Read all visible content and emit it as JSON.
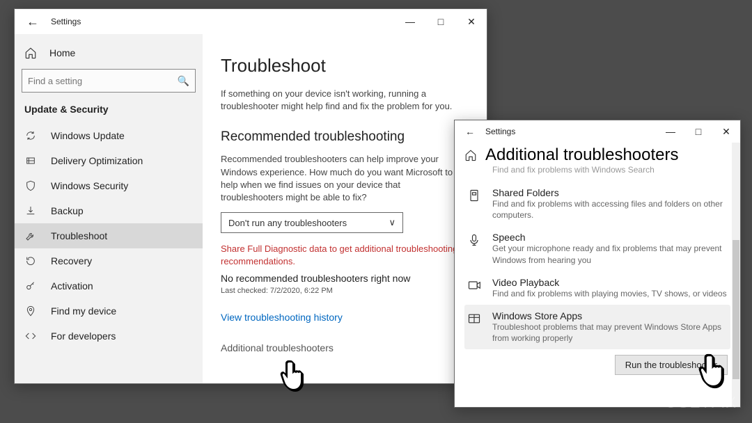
{
  "window1": {
    "title": "Settings",
    "home": "Home",
    "search_placeholder": "Find a setting",
    "category": "Update & Security",
    "sidebar": {
      "items": [
        {
          "label": "Windows Update"
        },
        {
          "label": "Delivery Optimization"
        },
        {
          "label": "Windows Security"
        },
        {
          "label": "Backup"
        },
        {
          "label": "Troubleshoot"
        },
        {
          "label": "Recovery"
        },
        {
          "label": "Activation"
        },
        {
          "label": "Find my device"
        },
        {
          "label": "For developers"
        }
      ]
    },
    "page": {
      "title": "Troubleshoot",
      "intro": "If something on your device isn't working, running a troubleshooter might help find and fix the problem for you.",
      "section_title": "Recommended troubleshooting",
      "section_desc": "Recommended troubleshooters can help improve your Windows experience. How much do you want Microsoft to help when we find issues on your device that troubleshooters might be able to fix?",
      "dropdown_value": "Don't run any troubleshooters",
      "warning": "Share Full Diagnostic data to get additional troubleshooting recommendations.",
      "no_rec": "No recommended troubleshooters right now",
      "last_checked": "Last checked: 7/2/2020, 6:22 PM",
      "history_link": "View troubleshooting history",
      "additional_link": "Additional troubleshooters"
    }
  },
  "window2": {
    "title": "Settings",
    "page_title": "Additional troubleshooters",
    "faded_line": "Find and fix problems with Windows Search",
    "items": [
      {
        "title": "Shared Folders",
        "desc": "Find and fix problems with accessing files and folders on other computers."
      },
      {
        "title": "Speech",
        "desc": "Get your microphone ready and fix problems that may prevent Windows from hearing you"
      },
      {
        "title": "Video Playback",
        "desc": "Find and fix problems with playing movies, TV shows, or videos"
      },
      {
        "title": "Windows Store Apps",
        "desc": "Troubleshoot problems that may prevent Windows Store Apps from working properly"
      }
    ],
    "run_button": "Run the troubleshooter"
  },
  "watermark": "UGETFIX"
}
